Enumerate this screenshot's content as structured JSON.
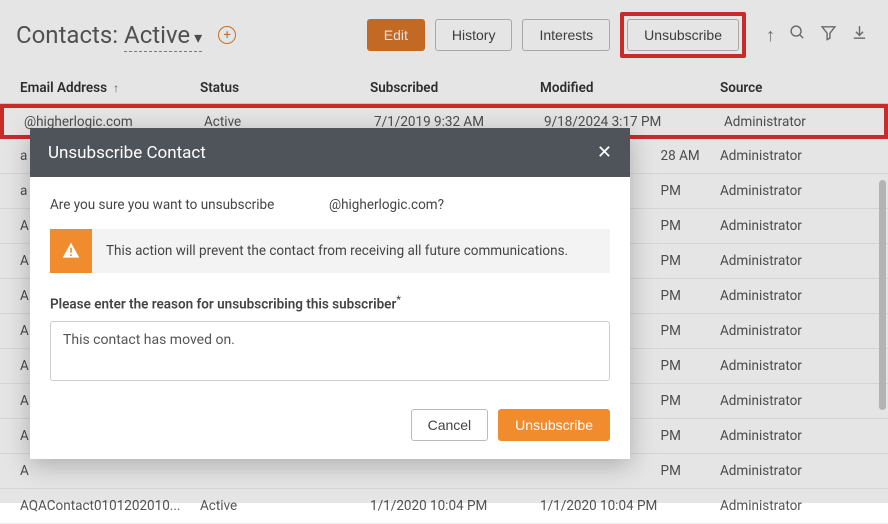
{
  "header": {
    "title_prefix": "Contacts:",
    "filter": "Active",
    "edit": "Edit",
    "history": "History",
    "interests": "Interests",
    "unsubscribe": "Unsubscribe"
  },
  "columns": {
    "email": "Email Address",
    "status": "Status",
    "subscribed": "Subscribed",
    "modified": "Modified",
    "source": "Source"
  },
  "rows": [
    {
      "email": "          @higherlogic.com",
      "status": "Active",
      "subscribed": "7/1/2019 9:32 AM",
      "modified": "9/18/2024 3:17 PM",
      "source": "Administrator"
    },
    {
      "email": "a",
      "status": "",
      "subscribed": "",
      "modified": "                                    28 AM",
      "source": "Administrator"
    },
    {
      "email": "a",
      "status": "",
      "subscribed": "",
      "modified": "                                    PM",
      "source": "Administrator"
    },
    {
      "email": "A",
      "status": "",
      "subscribed": "",
      "modified": "                                    PM",
      "source": "Administrator"
    },
    {
      "email": "A",
      "status": "",
      "subscribed": "",
      "modified": "                                    PM",
      "source": "Administrator"
    },
    {
      "email": "A",
      "status": "",
      "subscribed": "",
      "modified": "                                    PM",
      "source": "Administrator"
    },
    {
      "email": "A",
      "status": "",
      "subscribed": "",
      "modified": "                                    PM",
      "source": "Administrator"
    },
    {
      "email": "A",
      "status": "",
      "subscribed": "",
      "modified": "                                    PM",
      "source": "Administrator"
    },
    {
      "email": "A",
      "status": "",
      "subscribed": "",
      "modified": "                                    PM",
      "source": "Administrator"
    },
    {
      "email": "A",
      "status": "",
      "subscribed": "",
      "modified": "                                    PM",
      "source": "Administrator"
    },
    {
      "email": "A",
      "status": "",
      "subscribed": "",
      "modified": "                                    PM",
      "source": "Administrator"
    },
    {
      "email": "AQAContact0101202010...",
      "status": "Active",
      "subscribed": "1/1/2020 10:04 PM",
      "modified": "1/1/2020 10:04 PM",
      "source": "Administrator"
    }
  ],
  "modal": {
    "title": "Unsubscribe Contact",
    "confirm_prefix": "Are you sure you want to unsubscribe",
    "confirm_email_suffix": "@higherlogic.com?",
    "warning": "This action will prevent the contact from receiving all future communications.",
    "reason_label": "Please enter the reason for unsubscribing this subscriber",
    "reason_asterisk": "*",
    "reason_value": "This contact has moved on.",
    "cancel": "Cancel",
    "submit": "Unsubscribe"
  }
}
